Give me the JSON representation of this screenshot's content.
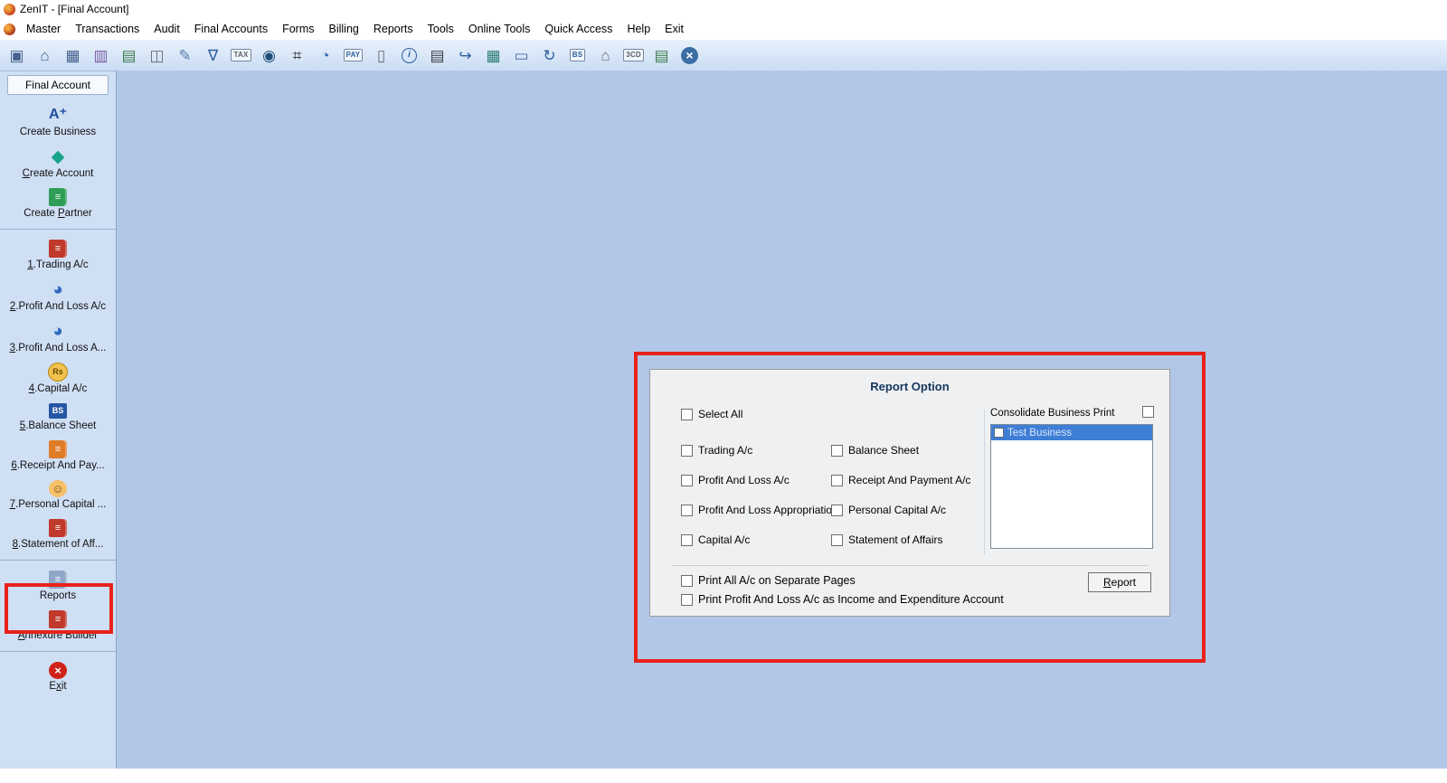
{
  "window": {
    "title": "ZenIT - [Final Account]"
  },
  "menubar": {
    "items": [
      "Master",
      "Transactions",
      "Audit",
      "Final Accounts",
      "Forms",
      "Billing",
      "Reports",
      "Tools",
      "Online Tools",
      "Quick Access",
      "Help",
      "Exit"
    ]
  },
  "toolbar": {
    "icons": [
      {
        "name": "new-window-icon",
        "glyph": "▣",
        "color": "#44618e"
      },
      {
        "name": "home-icon",
        "glyph": "⌂",
        "color": "#44618e"
      },
      {
        "name": "ledger-table-icon",
        "glyph": "▦",
        "color": "#44618e"
      },
      {
        "name": "bar-chart-icon",
        "glyph": "▥",
        "color": "#7a5ba6"
      },
      {
        "name": "schedule-icon",
        "glyph": "▤",
        "color": "#3f7d4f"
      },
      {
        "name": "users-group-icon",
        "glyph": "◫",
        "color": "#6b6f75"
      },
      {
        "name": "pen-tool-icon",
        "glyph": "✎",
        "color": "#5b7fae"
      },
      {
        "name": "filter-icon",
        "glyph": "∇",
        "color": "#2f5f9e"
      },
      {
        "name": "tax-badge-icon",
        "glyph": "TAX",
        "color": "#5a5f66",
        "cls": "text"
      },
      {
        "name": "audit-disc-icon",
        "glyph": "◉",
        "color": "#1f4e79"
      },
      {
        "name": "calculator-icon",
        "glyph": "⌗",
        "color": "#3a3f45"
      },
      {
        "name": "pie-chart-icon",
        "glyph": "◔",
        "color": "#356bb3"
      },
      {
        "name": "epay-icon",
        "glyph": "PAY",
        "color": "#2f5f9e",
        "cls": "text"
      },
      {
        "name": "blank-document-icon",
        "glyph": "▯",
        "color": "#6b6f75"
      },
      {
        "name": "info-icon",
        "glyph": "i",
        "color": "#2f5f9e",
        "cls": "ring"
      },
      {
        "name": "calc-sheet-icon",
        "glyph": "▤",
        "color": "#3a3f45"
      },
      {
        "name": "export-document-icon",
        "glyph": "↪",
        "color": "#2f5f9e"
      },
      {
        "name": "calendar-icon",
        "glyph": "▦",
        "color": "#2f7d74"
      },
      {
        "name": "monitor-icon",
        "glyph": "▭",
        "color": "#4a6da7"
      },
      {
        "name": "refresh-icon",
        "glyph": "↻",
        "color": "#2f5f9e"
      },
      {
        "name": "bs-document-icon",
        "glyph": "BS",
        "color": "#2f5f9e",
        "cls": "text"
      },
      {
        "name": "bank-icon",
        "glyph": "⌂",
        "color": "#6b6f75"
      },
      {
        "name": "3cd-document-icon",
        "glyph": "3CD",
        "color": "#5a5f66",
        "cls": "text"
      },
      {
        "name": "report-document-icon",
        "glyph": "▤",
        "color": "#3f7d4f"
      },
      {
        "name": "close-icon",
        "glyph": "×",
        "color": "#ffffff",
        "cls": "round"
      }
    ]
  },
  "sidebar": {
    "header": "Final Account",
    "groups": [
      {
        "items": [
          {
            "label": "Create Business",
            "hotkey": null,
            "icon": {
              "name": "create-business-icon",
              "glyph": "A⁺",
              "fg": "#1f4e9e",
              "cls": "text-lg"
            }
          },
          {
            "label": "Create Account",
            "hotkey": 0,
            "icon": {
              "name": "create-account-icon",
              "glyph": "◆",
              "fg": "#18a38a"
            }
          },
          {
            "label": "Create Partner",
            "hotkey": 7,
            "icon": {
              "name": "create-partner-icon",
              "glyph": "≡",
              "bg": "#2e9e57",
              "cls": "book"
            }
          }
        ]
      },
      {
        "items": [
          {
            "label": "1.Trading A/c",
            "hotkey": 0,
            "icon": {
              "name": "trading-book-icon",
              "glyph": "≡",
              "bg": "#c0392b",
              "cls": "book"
            }
          },
          {
            "label": "2.Profit And Loss A/c",
            "hotkey": 0,
            "icon": {
              "name": "profit-loss-pie-icon",
              "glyph": "◕",
              "fg": "#2f6bbf"
            }
          },
          {
            "label": "3.Profit And Loss A...",
            "hotkey": 0,
            "icon": {
              "name": "profit-loss-appropriation-pie-icon",
              "glyph": "◕",
              "fg": "#2f6bbf"
            }
          },
          {
            "label": "4.Capital A/c",
            "hotkey": 0,
            "icon": {
              "name": "capital-coin-icon",
              "glyph": "Rs",
              "bg": "#f2c14e",
              "fg": "#6b4a00",
              "cls": "coin"
            }
          },
          {
            "label": "5.Balance Sheet",
            "hotkey": 0,
            "icon": {
              "name": "balance-sheet-icon",
              "glyph": "BS",
              "bg": "#2456a4",
              "cls": "badge"
            }
          },
          {
            "label": "6.Receipt And Pay...",
            "hotkey": 0,
            "icon": {
              "name": "receipt-payment-icon",
              "glyph": "≡",
              "bg": "#e07b28",
              "cls": "book"
            }
          },
          {
            "label": "7.Personal Capital ...",
            "hotkey": 0,
            "icon": {
              "name": "personal-capital-icon",
              "glyph": "☺",
              "bg": "#f5c06a",
              "fg": "#7a4a10",
              "cls": "circle"
            }
          },
          {
            "label": "8.Statement of Aff...",
            "hotkey": 0,
            "icon": {
              "name": "statement-affairs-icon",
              "glyph": "≡",
              "bg": "#c0392b",
              "cls": "book"
            }
          }
        ]
      },
      {
        "items": [
          {
            "label": "Reports",
            "hotkey": null,
            "icon": {
              "name": "reports-icon",
              "glyph": "≡",
              "bg": "#8fa7c8",
              "cls": "book"
            }
          },
          {
            "label": "Annexure Builder",
            "hotkey": 0,
            "icon": {
              "name": "annexure-builder-icon",
              "glyph": "≡",
              "bg": "#c0392b",
              "cls": "book"
            }
          }
        ]
      },
      {
        "items": [
          {
            "label": "Exit",
            "hotkey": 1,
            "icon": {
              "name": "exit-icon",
              "glyph": "×",
              "bg": "#cf2318",
              "fg": "#ffffff",
              "cls": "circle"
            }
          }
        ]
      }
    ]
  },
  "dialog": {
    "title": "Report Option",
    "select_all_label": "Select All",
    "left_options": [
      "Trading A/c",
      "Profit And Loss A/c",
      "Profit And Loss Appropriation",
      "Capital A/c"
    ],
    "right_options": [
      "Balance Sheet",
      "Receipt And Payment A/c",
      "Personal Capital A/c",
      "Statement of Affairs"
    ],
    "consolidate_label": "Consolidate Business Print",
    "business_list": [
      {
        "label": "Test Business",
        "selected": true,
        "checked": false
      }
    ],
    "footer_options": [
      "Print All A/c on Separate Pages",
      "Print Profit And Loss A/c as Income and Expenditure Account"
    ],
    "report_button_label": "Report",
    "report_button_hotkey": 0
  },
  "annotations": {
    "color": "#e8221a"
  }
}
